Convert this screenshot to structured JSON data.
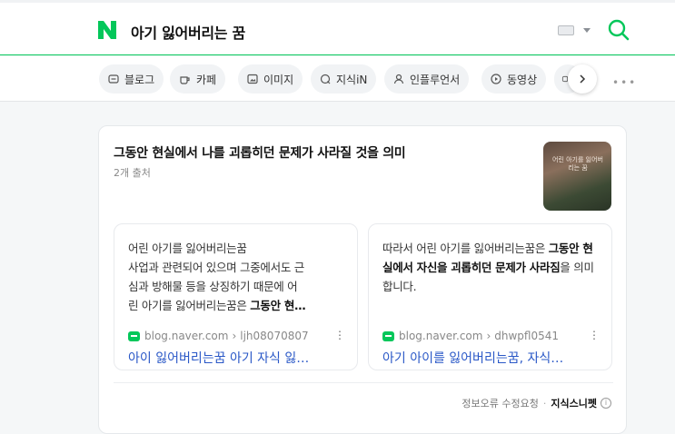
{
  "header": {
    "query": "아기 잃어버리는 꿈"
  },
  "tabs": [
    {
      "label": "블로그",
      "icon": "blog-icon"
    },
    {
      "label": "카페",
      "icon": "cafe-icon"
    },
    {
      "label": "이미지",
      "icon": "image-icon"
    },
    {
      "label": "지식iN",
      "icon": "kin-icon"
    },
    {
      "label": "인플루언서",
      "icon": "influencer-icon"
    },
    {
      "label": "동영상",
      "icon": "video-icon"
    }
  ],
  "colors": {
    "brand": "#03c75a",
    "link": "#2a58c7"
  },
  "card": {
    "title": "그동안 현실에서 나를 괴롭히던 문제가 사라질 것을 의미",
    "subtitle": "2개 출처",
    "thumb_text": "어린 아기를 잃어버리는 꿈",
    "sources": [
      {
        "text_lines": [
          "어린 아기를 잃어버리는꿈",
          "사업과 관련되어 있으며 그중에서도 근",
          "심과 방해물 등을 상징하기 때문에 어",
          "린 아기를 잃어버리는꿈은 "
        ],
        "text_bold_tail": "그동안 현…",
        "domain": "blog.naver.com",
        "author": "ljh08070807",
        "title": "아이 잃어버리는꿈 아기 자식 잃…"
      },
      {
        "text_plain": "따라서 어린 아기를 잃어버리는꿈은 ",
        "text_bold": "그동안 현실에서 자신을 괴롭히던 문제가 사라짐",
        "text_tail": "을 의미합니다.",
        "domain": "blog.naver.com",
        "author": "dhwpfl0541",
        "title": "아기 아이를 잃어버리는꿈, 자식…"
      }
    ],
    "footer": {
      "report": "정보오류 수정요청",
      "separator": "·",
      "brand": "지식스니펫",
      "info": "i"
    }
  }
}
